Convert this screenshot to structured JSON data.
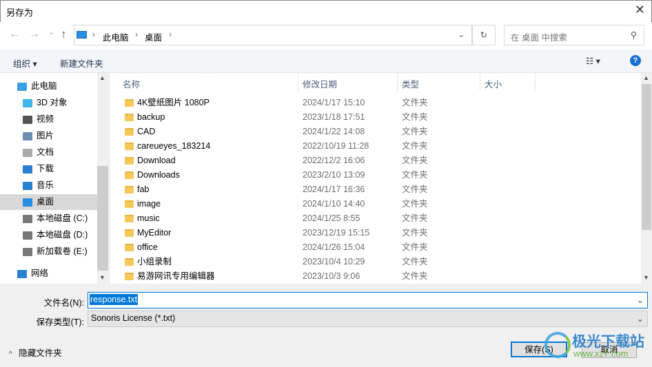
{
  "window": {
    "title": "另存为",
    "close": "✕"
  },
  "nav": {
    "back": "←",
    "forward": "→",
    "recent": "⌄",
    "up": "↑",
    "breadcrumb": [
      "此电脑",
      "桌面"
    ],
    "sep": "›",
    "dropdown": "⌄",
    "refresh": "↻",
    "search_placeholder": "在 桌面 中搜索",
    "search_icon": "⚲"
  },
  "toolbar": {
    "organize": "组织 ▾",
    "new_folder": "新建文件夹",
    "view": "☷ ▾",
    "help": "?"
  },
  "sidebar": [
    {
      "label": "此电脑",
      "icon": "computer-icon",
      "color": "#3a9ee4"
    },
    {
      "label": "3D 对象",
      "icon": "3d-objects-icon",
      "color": "#3fb4e8"
    },
    {
      "label": "视频",
      "icon": "video-icon",
      "color": "#555"
    },
    {
      "label": "图片",
      "icon": "pictures-icon",
      "color": "#6a8fb0"
    },
    {
      "label": "文档",
      "icon": "documents-icon",
      "color": "#aaa"
    },
    {
      "label": "下载",
      "icon": "download-icon",
      "color": "#2a7fd4"
    },
    {
      "label": "音乐",
      "icon": "music-icon",
      "color": "#2a7fd4"
    },
    {
      "label": "桌面",
      "icon": "desktop-icon",
      "color": "#2a8fe0"
    },
    {
      "label": "本地磁盘 (C:)",
      "icon": "drive-icon",
      "color": "#777"
    },
    {
      "label": "本地磁盘 (D:)",
      "icon": "drive-icon",
      "color": "#777"
    },
    {
      "label": "新加载卷 (E:)",
      "icon": "drive-icon",
      "color": "#777"
    },
    {
      "label": "网络",
      "icon": "network-icon",
      "color": "#2a7fd4"
    }
  ],
  "columns": {
    "name": "名称",
    "date": "修改日期",
    "type": "类型",
    "size": "大小"
  },
  "files": [
    {
      "name": "4K壁纸图片 1080P",
      "date": "2024/1/17 15:10",
      "type": "文件夹"
    },
    {
      "name": "backup",
      "date": "2023/1/18 17:51",
      "type": "文件夹"
    },
    {
      "name": "CAD",
      "date": "2024/1/22 14:08",
      "type": "文件夹"
    },
    {
      "name": "careueyes_183214",
      "date": "2022/10/19 11:28",
      "type": "文件夹"
    },
    {
      "name": "Download",
      "date": "2022/12/2 16:06",
      "type": "文件夹"
    },
    {
      "name": "Downloads",
      "date": "2023/2/10 13:09",
      "type": "文件夹"
    },
    {
      "name": "fab",
      "date": "2024/1/17 16:36",
      "type": "文件夹"
    },
    {
      "name": "image",
      "date": "2024/1/10 14:40",
      "type": "文件夹"
    },
    {
      "name": "music",
      "date": "2024/1/25 8:55",
      "type": "文件夹"
    },
    {
      "name": "MyEditor",
      "date": "2023/12/19 15:15",
      "type": "文件夹"
    },
    {
      "name": "office",
      "date": "2024/1/26 15:04",
      "type": "文件夹"
    },
    {
      "name": "小组录制",
      "date": "2023/10/4 10:29",
      "type": "文件夹"
    },
    {
      "name": "易游网讯专用编辑器",
      "date": "2023/10/3 9:06",
      "type": "文件夹"
    }
  ],
  "form": {
    "filename_label": "文件名(N):",
    "filename": "response.txt",
    "filetype_label": "保存类型(T):",
    "filetype": "Sonoris License (*.txt)"
  },
  "footer": {
    "hide_folders": "隐藏文件夹",
    "save": "保存(S)",
    "cancel": "取消"
  },
  "watermark": {
    "text": "极光下载站",
    "url": "www.xz7.com"
  }
}
